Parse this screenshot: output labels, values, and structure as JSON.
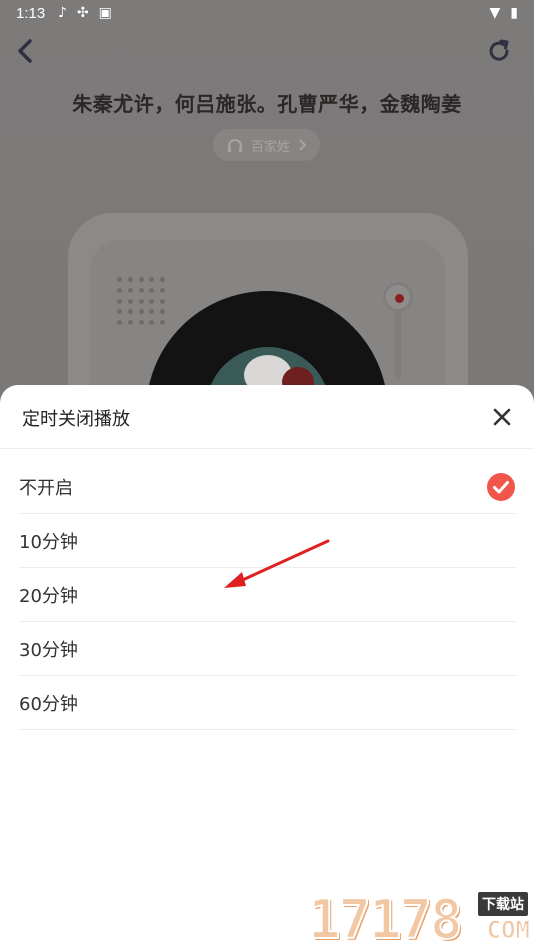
{
  "status_bar": {
    "time": "1:13",
    "left_icons": [
      "music-note-icon",
      "sync-icon",
      "text-a-icon"
    ],
    "right_icons": [
      "wifi-icon",
      "battery-icon"
    ]
  },
  "header": {
    "back_icon": "chevron-left-icon",
    "refresh_icon": "refresh-icon"
  },
  "content": {
    "poem_line": "朱秦尤许，何吕施张。孔曹严华，金魏陶姜",
    "category_pill": {
      "label": "百家姓",
      "icon": "headphones-icon",
      "chevron": "chevron-right-icon"
    }
  },
  "sheet": {
    "title": "定时关闭播放",
    "close_icon": "close-icon",
    "options": [
      {
        "label": "不开启",
        "selected": true
      },
      {
        "label": "10分钟",
        "selected": false
      },
      {
        "label": "20分钟",
        "selected": false
      },
      {
        "label": "30分钟",
        "selected": false
      },
      {
        "label": "60分钟",
        "selected": false
      }
    ],
    "check_icon": "check-circle-icon"
  },
  "colors": {
    "accent": "#f2564a",
    "annotation_arrow": "#e02020",
    "overlay": "#7c7878"
  },
  "watermark": {
    "digits": "17178",
    "site": "下载站",
    "domain": "COM"
  }
}
